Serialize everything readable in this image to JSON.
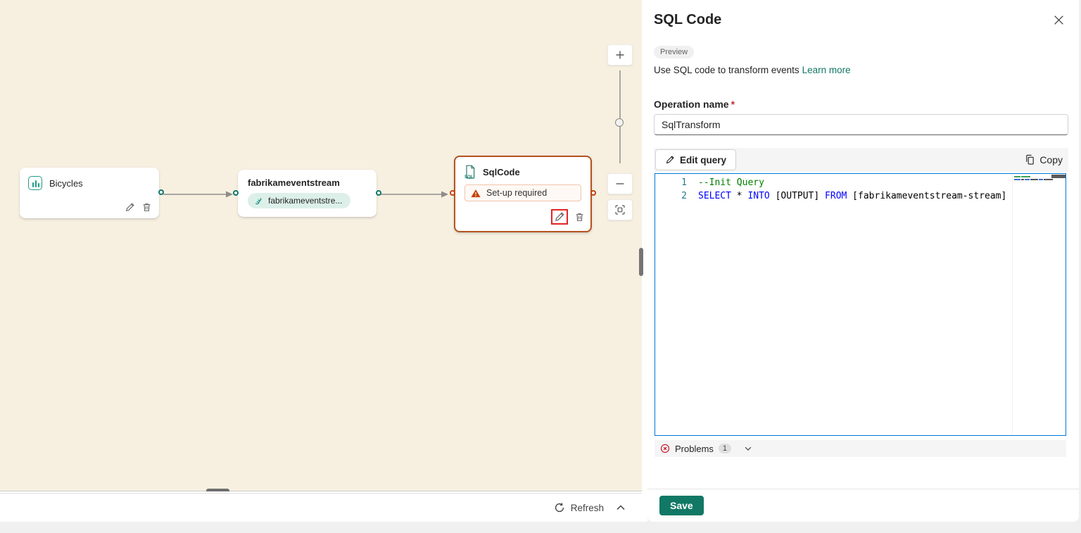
{
  "canvas": {
    "nodes": {
      "bicycles": {
        "title": "Bicycles"
      },
      "eventstream": {
        "title": "fabrikameventstream",
        "badge": "fabrikameventstre..."
      },
      "sqlcode": {
        "title": "SqlCode",
        "warning": "Set-up required"
      }
    },
    "refresh_label": "Refresh"
  },
  "panel": {
    "title": "SQL Code",
    "preview_badge": "Preview",
    "description": "Use SQL code to transform events",
    "learn_more": "Learn more",
    "operation_name": {
      "label": "Operation name",
      "required_mark": "*",
      "value": "SqlTransform"
    },
    "toolbar": {
      "edit_query": "Edit query",
      "copy": "Copy"
    },
    "editor": {
      "language": "sql",
      "lines": [
        {
          "number": "1",
          "tokens": [
            {
              "text": "--Init Query",
              "type": "comment"
            }
          ]
        },
        {
          "number": "2",
          "tokens": [
            {
              "text": "SELECT",
              "type": "keyword"
            },
            {
              "text": " * ",
              "type": "plain"
            },
            {
              "text": "INTO",
              "type": "keyword"
            },
            {
              "text": " [OUTPUT] ",
              "type": "plain"
            },
            {
              "text": "FROM",
              "type": "keyword"
            },
            {
              "text": " [fabrikameventstream-stream]",
              "type": "plain"
            }
          ]
        }
      ]
    },
    "problems": {
      "label": "Problems",
      "count": "1"
    },
    "save_label": "Save"
  },
  "colors": {
    "brand_teal": "#117865",
    "canvas_bg": "#F7F0E1",
    "editor_focus_border": "#0078D4",
    "node_error_border": "#B5541F",
    "warning_orange": "#C4420B",
    "annotation_red": "#E32424",
    "error_red": "#C50F1F",
    "keyword_blue": "#0000FF",
    "comment_green": "#008000"
  }
}
